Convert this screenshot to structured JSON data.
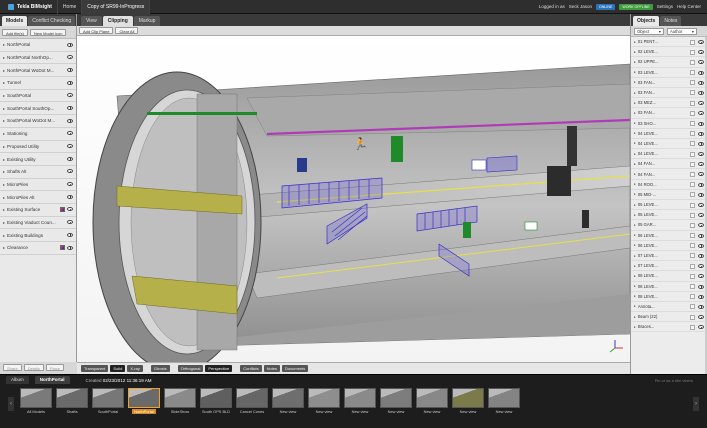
{
  "topbar": {
    "app_title": "Tekla BIMsight",
    "tabs": [
      "Home",
      "Copy of SR99-InProgress"
    ],
    "logged_in": "Logged in as",
    "user": "Seck Jason",
    "badge_online": "ONLINE",
    "badge_sync": "WORK OFFLINE",
    "settings": "Settings",
    "help": "Help Center"
  },
  "left": {
    "tabs": [
      "Models",
      "Conflict Checking"
    ],
    "buttons": [
      "Add file(s)",
      "New Model icon"
    ],
    "items": [
      {
        "label": "NorthPortal",
        "color_sq": false
      },
      {
        "label": "NorthPortal NorthOp...",
        "color_sq": false
      },
      {
        "label": "NorthPortal WoDot M...",
        "color_sq": false
      },
      {
        "label": "Tunnel",
        "color_sq": false
      },
      {
        "label": "SouthPortal",
        "color_sq": false
      },
      {
        "label": "SouthPortal SouthOp...",
        "color_sq": false
      },
      {
        "label": "SouthPortal WoDot M...",
        "color_sq": false
      },
      {
        "label": "Stationing",
        "color_sq": false
      },
      {
        "label": "Proposed Utility",
        "color_sq": false
      },
      {
        "label": "Existing Utility",
        "color_sq": false
      },
      {
        "label": "Shafts Alt",
        "color_sq": false
      },
      {
        "label": "MicroPiles",
        "color_sq": false
      },
      {
        "label": "MicroPiles Alt",
        "color_sq": false
      },
      {
        "label": "Existing Surface",
        "color_sq": true
      },
      {
        "label": "Existing Viaduct Coun...",
        "color_sq": false
      },
      {
        "label": "Existing Buildings",
        "color_sq": false
      },
      {
        "label": "Clearance",
        "color_sq": true
      }
    ],
    "footer_buttons": [
      "Share",
      "Details",
      "Place"
    ]
  },
  "center": {
    "tabs": [
      "View",
      "Clipping",
      "Markup"
    ],
    "active_tab": "Clipping",
    "clip_buttons": [
      "Add Clip Plane",
      "Clear All"
    ],
    "view_toolbar": [
      "Transparent",
      "Solid",
      "X-ray",
      "Ghosts",
      "Orthogonal",
      "Perspective",
      "Conflicts",
      "Notes",
      "Documents"
    ],
    "active_view_buttons": [
      "Solid",
      "Perspective"
    ],
    "colors": {
      "tunnel_gray": "#b9b9b9",
      "deck": "#c9c9c9",
      "stair_blue": "#3a2ec8",
      "rail_magenta": "#b03ab8",
      "egress_green": "#1f8a2a",
      "yellow_deck": "#b5b04a",
      "floor_line": "#e6e04a"
    }
  },
  "right": {
    "tabs": [
      "Objects",
      "Notes"
    ],
    "filters": [
      "Object",
      "Author"
    ],
    "items": [
      "01 PENT...",
      "02 LEVE...",
      "02 UPPE...",
      "03 LEVE...",
      "03 FAN...",
      "03 FAN...",
      "03 MEZ...",
      "03 FAN...",
      "03 SHO...",
      "04 LEVE...",
      "04 LEVE...",
      "04 LEVE...",
      "04 FAN...",
      "04 FAN...",
      "04 ROO...",
      "05 MID-...",
      "05 LEVE...",
      "05 LEVE...",
      "05 GAR...",
      "06 LEVE...",
      "06 LEVE...",
      "07 LEVE...",
      "07 LEVE...",
      "08 LEVE...",
      "08 LEVE...",
      "08 LEVE...",
      "Annota...",
      "Beam (22)",
      "Braces..."
    ]
  },
  "bottom": {
    "album_label": "Album",
    "album_tab": "NorthPortal",
    "created_label": "Created",
    "created_value": "02/23/2012 11:36:19 AM",
    "pin_hint": "Pin or as a title vibers",
    "thumbs": [
      {
        "label": "All Models",
        "tint": "#7a7a7a"
      },
      {
        "label": "Shafts",
        "tint": "#6a6a6a"
      },
      {
        "label": "SouthPortal",
        "tint": "#777"
      },
      {
        "label": "NorthPortal",
        "tint": "#6a6a6a"
      },
      {
        "label": "SlideShow",
        "tint": "#8a8a8a"
      },
      {
        "label": "South OPS BLD",
        "tint": "#5f5f5f"
      },
      {
        "label": "Cancel Cones",
        "tint": "#666"
      },
      {
        "label": "New view",
        "tint": "#6e6e6e"
      },
      {
        "label": "New view",
        "tint": "#8e8e8e"
      },
      {
        "label": "New view",
        "tint": "#8a8a8a"
      },
      {
        "label": "New view",
        "tint": "#7d7d7d"
      },
      {
        "label": "New view",
        "tint": "#888"
      },
      {
        "label": "New view",
        "tint": "#7a7a4a"
      },
      {
        "label": "New view",
        "tint": "#848484"
      }
    ],
    "active_thumb": 3
  }
}
